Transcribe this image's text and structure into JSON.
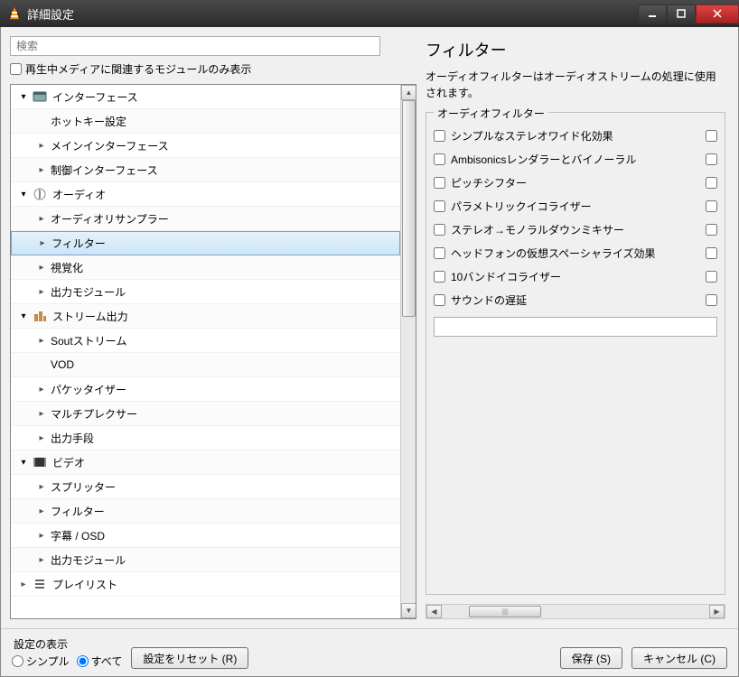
{
  "window": {
    "title": "詳細設定"
  },
  "left": {
    "search_placeholder": "検索",
    "module_checkbox_label": "再生中メディアに関連するモジュールのみ表示"
  },
  "tree": [
    {
      "label": "インターフェース",
      "level": 0,
      "expand": "open",
      "icon": "interface"
    },
    {
      "label": "ホットキー設定",
      "level": 1,
      "expand": "none"
    },
    {
      "label": "メインインターフェース",
      "level": 1,
      "expand": "closed"
    },
    {
      "label": "制御インターフェース",
      "level": 1,
      "expand": "closed"
    },
    {
      "label": "オーディオ",
      "level": 0,
      "expand": "open",
      "icon": "audio"
    },
    {
      "label": "オーディオリサンプラー",
      "level": 1,
      "expand": "closed"
    },
    {
      "label": "フィルター",
      "level": 1,
      "expand": "closed",
      "selected": true
    },
    {
      "label": "視覚化",
      "level": 1,
      "expand": "closed"
    },
    {
      "label": "出力モジュール",
      "level": 1,
      "expand": "closed"
    },
    {
      "label": "ストリーム出力",
      "level": 0,
      "expand": "open",
      "icon": "stream"
    },
    {
      "label": "Soutストリーム",
      "level": 1,
      "expand": "closed"
    },
    {
      "label": "VOD",
      "level": 1,
      "expand": "none"
    },
    {
      "label": "パケッタイザー",
      "level": 1,
      "expand": "closed"
    },
    {
      "label": "マルチプレクサー",
      "level": 1,
      "expand": "closed"
    },
    {
      "label": "出力手段",
      "level": 1,
      "expand": "closed"
    },
    {
      "label": "ビデオ",
      "level": 0,
      "expand": "open",
      "icon": "video"
    },
    {
      "label": "スプリッター",
      "level": 1,
      "expand": "closed"
    },
    {
      "label": "フィルター",
      "level": 1,
      "expand": "closed"
    },
    {
      "label": "字幕 / OSD",
      "level": 1,
      "expand": "closed"
    },
    {
      "label": "出力モジュール",
      "level": 1,
      "expand": "closed"
    },
    {
      "label": "プレイリスト",
      "level": 0,
      "expand": "closed",
      "icon": "playlist"
    }
  ],
  "right": {
    "title": "フィルター",
    "desc": "オーディオフィルターはオーディオストリームの処理に使用されます。",
    "group_label": "オーディオフィルター",
    "filters": [
      {
        "label": "シンプルなステレオワイド化効果"
      },
      {
        "label": "Ambisonicsレンダラーとバイノーラル"
      },
      {
        "label": "ピッチシフター"
      },
      {
        "label": "パラメトリックイコライザー"
      },
      {
        "label": "ステレオ→モノラルダウンミキサー"
      },
      {
        "label": "ヘッドフォンの仮想スペーシャライズ効果"
      },
      {
        "label": "10バンドイコライザー"
      },
      {
        "label": "サウンドの遅延"
      }
    ]
  },
  "footer": {
    "mode_label": "設定の表示",
    "radio_simple": "シンプル",
    "radio_all": "すべて",
    "reset": "設定をリセット (R)",
    "save": "保存 (S)",
    "cancel": "キャンセル (C)"
  }
}
